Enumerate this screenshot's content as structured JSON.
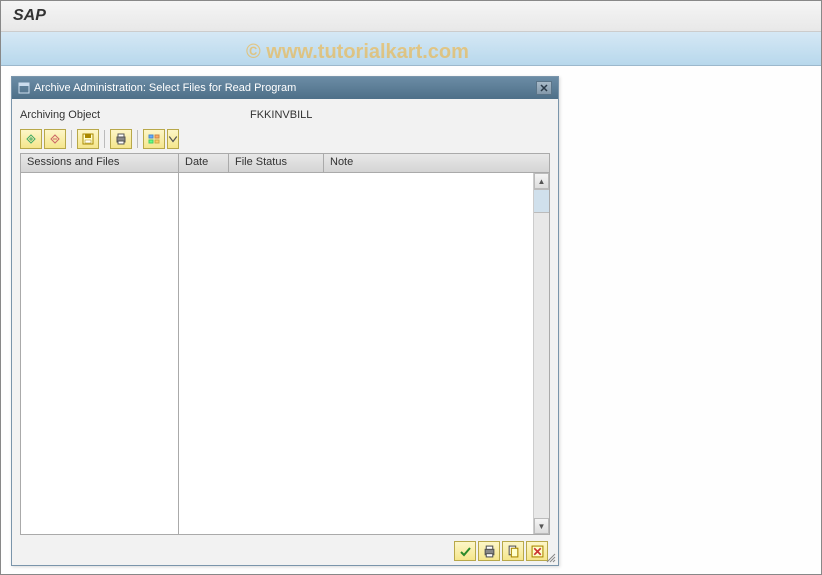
{
  "app": {
    "title": "SAP"
  },
  "watermark": "© www.tutorialkart.com",
  "popup": {
    "title": "Archive Administration: Select Files for Read Program",
    "field_label": "Archiving Object",
    "field_value": "FKKINVBILL"
  },
  "columns": {
    "sessions": "Sessions and Files",
    "date": "Date",
    "status": "File Status",
    "note": "Note"
  },
  "icons": {
    "expand_all": "expand-all-icon",
    "collapse_all": "collapse-all-icon",
    "save": "save-icon",
    "print": "print-icon",
    "layout": "layout-icon",
    "layout_dd": "layout-dropdown-icon",
    "check": "check-icon",
    "print2": "print-icon",
    "copy": "copy-icon",
    "close": "cancel-icon"
  }
}
